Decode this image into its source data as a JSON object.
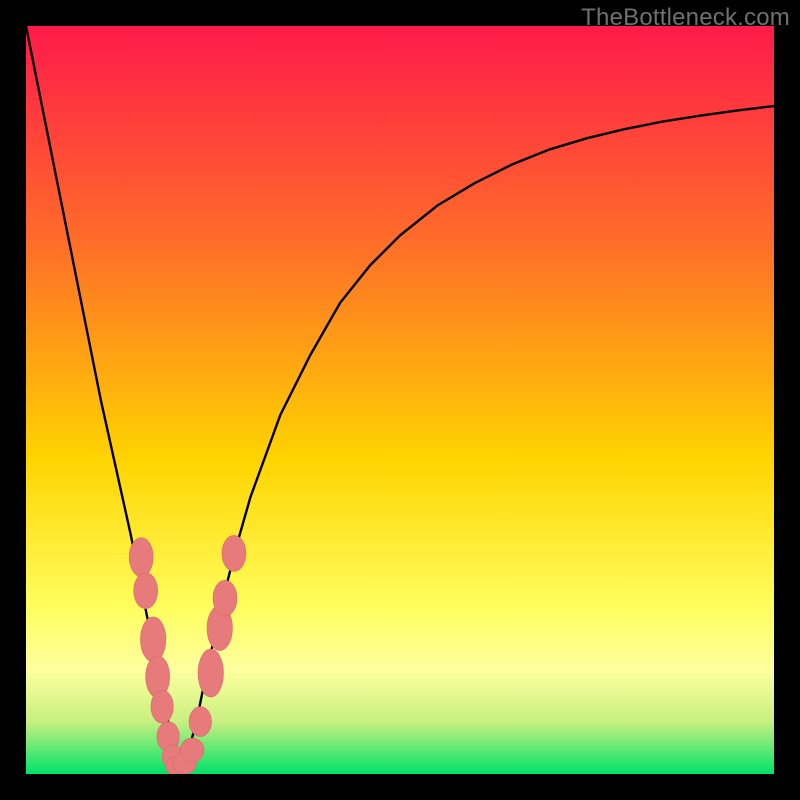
{
  "watermark": "TheBottleneck.com",
  "colors": {
    "gradient_top": "#ff1a4a",
    "gradient_mid1": "#ff6a2a",
    "gradient_mid2": "#ffd400",
    "gradient_mid3": "#ffff60",
    "gradient_mid4": "#ffffa0",
    "gradient_bot1": "#c8f080",
    "gradient_bottom": "#00e26a",
    "curve": "#000000",
    "marker_fill": "#e77a7a",
    "marker_stroke": "#d86a6a"
  },
  "chart_data": {
    "type": "line",
    "title": "",
    "xlabel": "",
    "ylabel": "",
    "xlim": [
      0,
      100
    ],
    "ylim": [
      0,
      100
    ],
    "series": [
      {
        "name": "bottleneck-curve",
        "x": [
          0,
          2,
          4,
          6,
          8,
          10,
          12,
          14,
          16,
          17,
          18,
          19,
          19.5,
          20,
          20.5,
          21,
          22,
          23,
          24,
          26,
          28,
          30,
          34,
          38,
          42,
          46,
          50,
          55,
          60,
          65,
          70,
          75,
          80,
          85,
          90,
          95,
          100
        ],
        "y": [
          100,
          90,
          80,
          70,
          60,
          50,
          41,
          32,
          22,
          17,
          12,
          7,
          4,
          1,
          0,
          1,
          4,
          8,
          13,
          22,
          30,
          37,
          48,
          56,
          63,
          68,
          72,
          76,
          79,
          81.5,
          83.5,
          85,
          86.2,
          87.2,
          88,
          88.7,
          89.3
        ]
      }
    ],
    "markers": [
      {
        "x": 15.4,
        "y": 29.0,
        "rx": 1.6,
        "ry": 2.6
      },
      {
        "x": 16.0,
        "y": 24.5,
        "rx": 1.6,
        "ry": 2.4
      },
      {
        "x": 17.0,
        "y": 18.0,
        "rx": 1.7,
        "ry": 3.0
      },
      {
        "x": 17.6,
        "y": 13.0,
        "rx": 1.6,
        "ry": 2.8
      },
      {
        "x": 18.2,
        "y": 9.0,
        "rx": 1.5,
        "ry": 2.2
      },
      {
        "x": 19.0,
        "y": 5.0,
        "rx": 1.5,
        "ry": 2.0
      },
      {
        "x": 19.6,
        "y": 2.3,
        "rx": 1.4,
        "ry": 1.6
      },
      {
        "x": 20.3,
        "y": 1.0,
        "rx": 1.6,
        "ry": 1.4
      },
      {
        "x": 21.2,
        "y": 1.4,
        "rx": 1.6,
        "ry": 1.4
      },
      {
        "x": 22.2,
        "y": 3.2,
        "rx": 1.6,
        "ry": 1.6
      },
      {
        "x": 23.3,
        "y": 7.0,
        "rx": 1.5,
        "ry": 2.0
      },
      {
        "x": 24.7,
        "y": 13.5,
        "rx": 1.7,
        "ry": 3.2
      },
      {
        "x": 25.9,
        "y": 19.5,
        "rx": 1.7,
        "ry": 3.0
      },
      {
        "x": 26.6,
        "y": 23.5,
        "rx": 1.6,
        "ry": 2.4
      },
      {
        "x": 27.8,
        "y": 29.5,
        "rx": 1.6,
        "ry": 2.4
      }
    ]
  }
}
